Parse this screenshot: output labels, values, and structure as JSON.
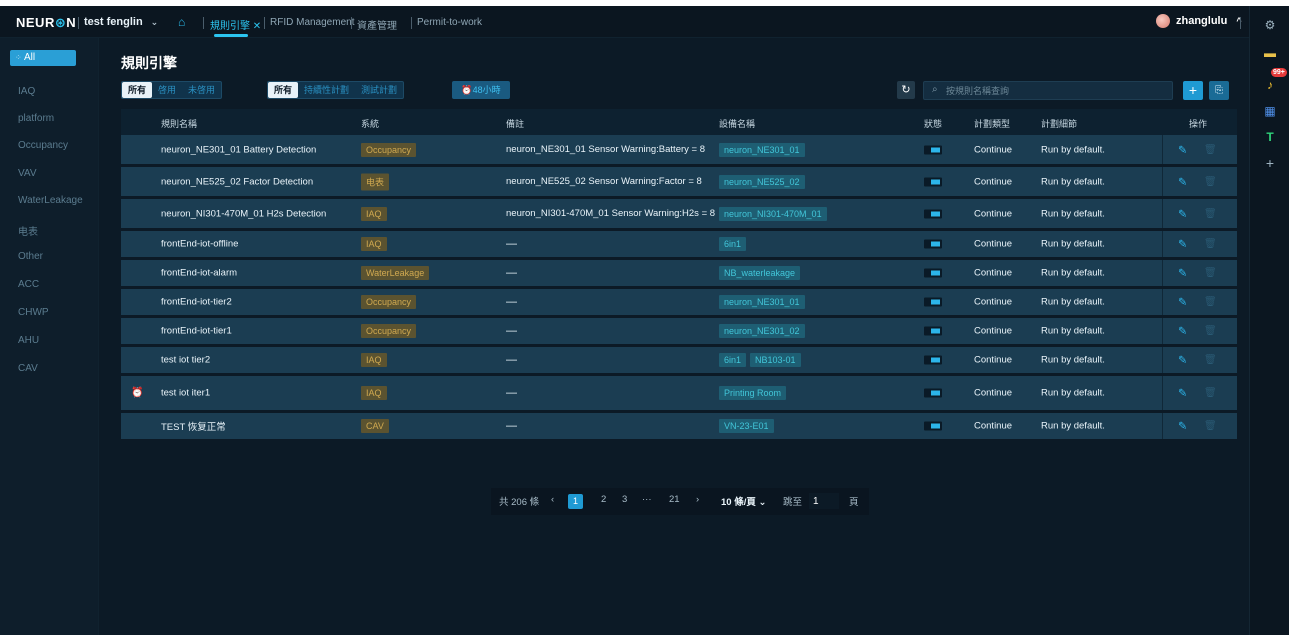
{
  "header": {
    "logo": "NEUR",
    "logo_dot": "⊛",
    "logo_end": "N",
    "project": "test fenglin",
    "tabs": [
      {
        "label": "規則引擎",
        "close": "✕"
      },
      {
        "label": "RFID Management"
      },
      {
        "label": "資產管理"
      },
      {
        "label": "Permit-to-work"
      }
    ],
    "user": "zhanglulu"
  },
  "rightrail": {
    "badge": "99+"
  },
  "sidebar": {
    "items": [
      "All",
      "IAQ",
      "platform",
      "Occupancy",
      "VAV",
      "WaterLeakage",
      "电表",
      "Other",
      "ACC",
      "CHWP",
      "AHU",
      "CAV"
    ]
  },
  "page": {
    "title": "規則引擎",
    "filter_status": [
      "所有",
      "啓用",
      "未啓用"
    ],
    "filter_plan": [
      "所有",
      "持續性計劃",
      "測試計劃"
    ],
    "hours_btn": "48小時",
    "search_placeholder": "按規則名稱查詢"
  },
  "table": {
    "headers": [
      "規則名稱",
      "系統",
      "備註",
      "設備名稱",
      "狀態",
      "計劃類型",
      "計劃細節",
      "操作"
    ],
    "rows": [
      {
        "name": "neuron_NE301_01 Battery Detection",
        "system": "Occupancy",
        "note": "neuron_NE301_01 Sensor Warning:Battery = 8",
        "devices": [
          "neuron_NE301_01"
        ],
        "ptype": "Continue",
        "pdetail": "Run by default."
      },
      {
        "name": "neuron_NE525_02 Factor Detection",
        "system": "电表",
        "note": "neuron_NE525_02 Sensor Warning:Factor = 8",
        "devices": [
          "neuron_NE525_02"
        ],
        "ptype": "Continue",
        "pdetail": "Run by default."
      },
      {
        "name": "neuron_NI301-470M_01 H2s Detection",
        "system": "IAQ",
        "note": "neuron_NI301-470M_01 Sensor Warning:H2s = 8",
        "devices": [
          "neuron_NI301-470M_01"
        ],
        "ptype": "Continue",
        "pdetail": "Run by default."
      },
      {
        "name": "frontEnd-iot-offline",
        "system": "IAQ",
        "note": "—",
        "devices": [
          "6in1"
        ],
        "ptype": "Continue",
        "pdetail": "Run by default."
      },
      {
        "name": "frontEnd-iot-alarm",
        "system": "WaterLeakage",
        "note": "—",
        "devices": [
          "NB_waterleakage"
        ],
        "ptype": "Continue",
        "pdetail": "Run by default."
      },
      {
        "name": "frontEnd-iot-tier2",
        "system": "Occupancy",
        "note": "—",
        "devices": [
          "neuron_NE301_01"
        ],
        "ptype": "Continue",
        "pdetail": "Run by default."
      },
      {
        "name": "frontEnd-iot-tier1",
        "system": "Occupancy",
        "note": "—",
        "devices": [
          "neuron_NE301_02"
        ],
        "ptype": "Continue",
        "pdetail": "Run by default."
      },
      {
        "name": "test iot tier2",
        "system": "IAQ",
        "note": "—",
        "devices": [
          "6in1",
          "NB103-01"
        ],
        "ptype": "Continue",
        "pdetail": "Run by default."
      },
      {
        "name": "test iot iter1",
        "system": "IAQ",
        "note": "—",
        "devices": [
          "Printing Room"
        ],
        "ptype": "Continue",
        "pdetail": "Run by default.",
        "alarm_icon": true
      },
      {
        "name": "TEST 恢复正常",
        "system": "CAV",
        "note": "—",
        "devices": [
          "VN-23-E01"
        ],
        "ptype": "Continue",
        "pdetail": "Run by default."
      }
    ]
  },
  "pagination": {
    "total": "共 206 條",
    "prev": "‹",
    "pages": [
      "1",
      "2",
      "3",
      "···",
      "21"
    ],
    "next": "›",
    "page_size": "10 條/頁",
    "jump_label": "跳至",
    "jump_value": "1",
    "jump_suffix": "頁"
  },
  "colors": {
    "accent": "#2cc5f0",
    "system_tag_bg": "#5b5330",
    "system_tag_fg": "#d0a950",
    "device_tag_bg": "#1e5e73",
    "device_tag_fg": "#42c6d9"
  }
}
